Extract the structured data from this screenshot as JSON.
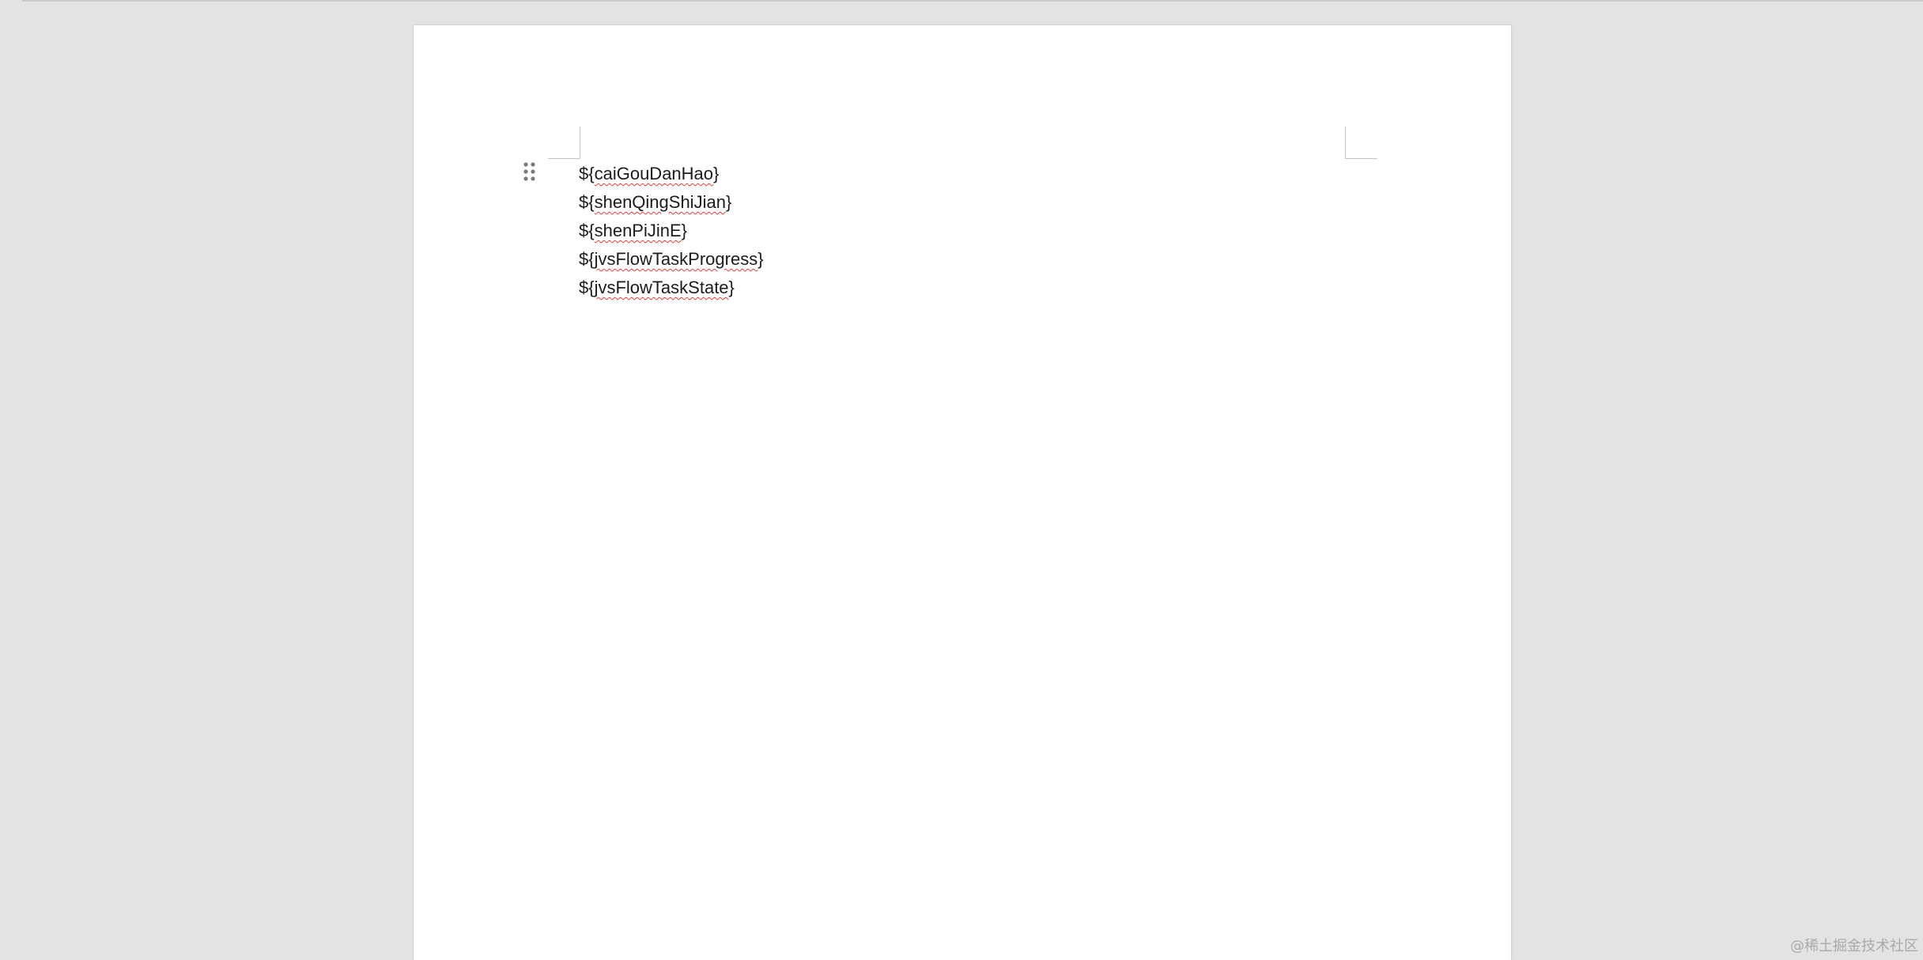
{
  "document": {
    "placeholders": [
      {
        "prefix": "${",
        "field": "caiGouDanHao",
        "suffix": "}"
      },
      {
        "prefix": "${",
        "field": "shenQingShiJian",
        "suffix": "}"
      },
      {
        "prefix": "${",
        "field": "shenPiJinE",
        "suffix": "}"
      },
      {
        "prefix": "${",
        "field": "jvsFlowTaskProgress",
        "suffix": "}"
      },
      {
        "prefix": "${",
        "field": "jvsFlowTaskState",
        "suffix": "}"
      }
    ]
  },
  "watermark": "@稀土掘金技术社区",
  "icons": {
    "drag_handle": "drag-handle-icon"
  },
  "colors": {
    "workspace_bg": "#e3e3e3",
    "page_bg": "#ffffff",
    "spellcheck_underline": "#e23a3a",
    "text": "#1b1b1b"
  }
}
